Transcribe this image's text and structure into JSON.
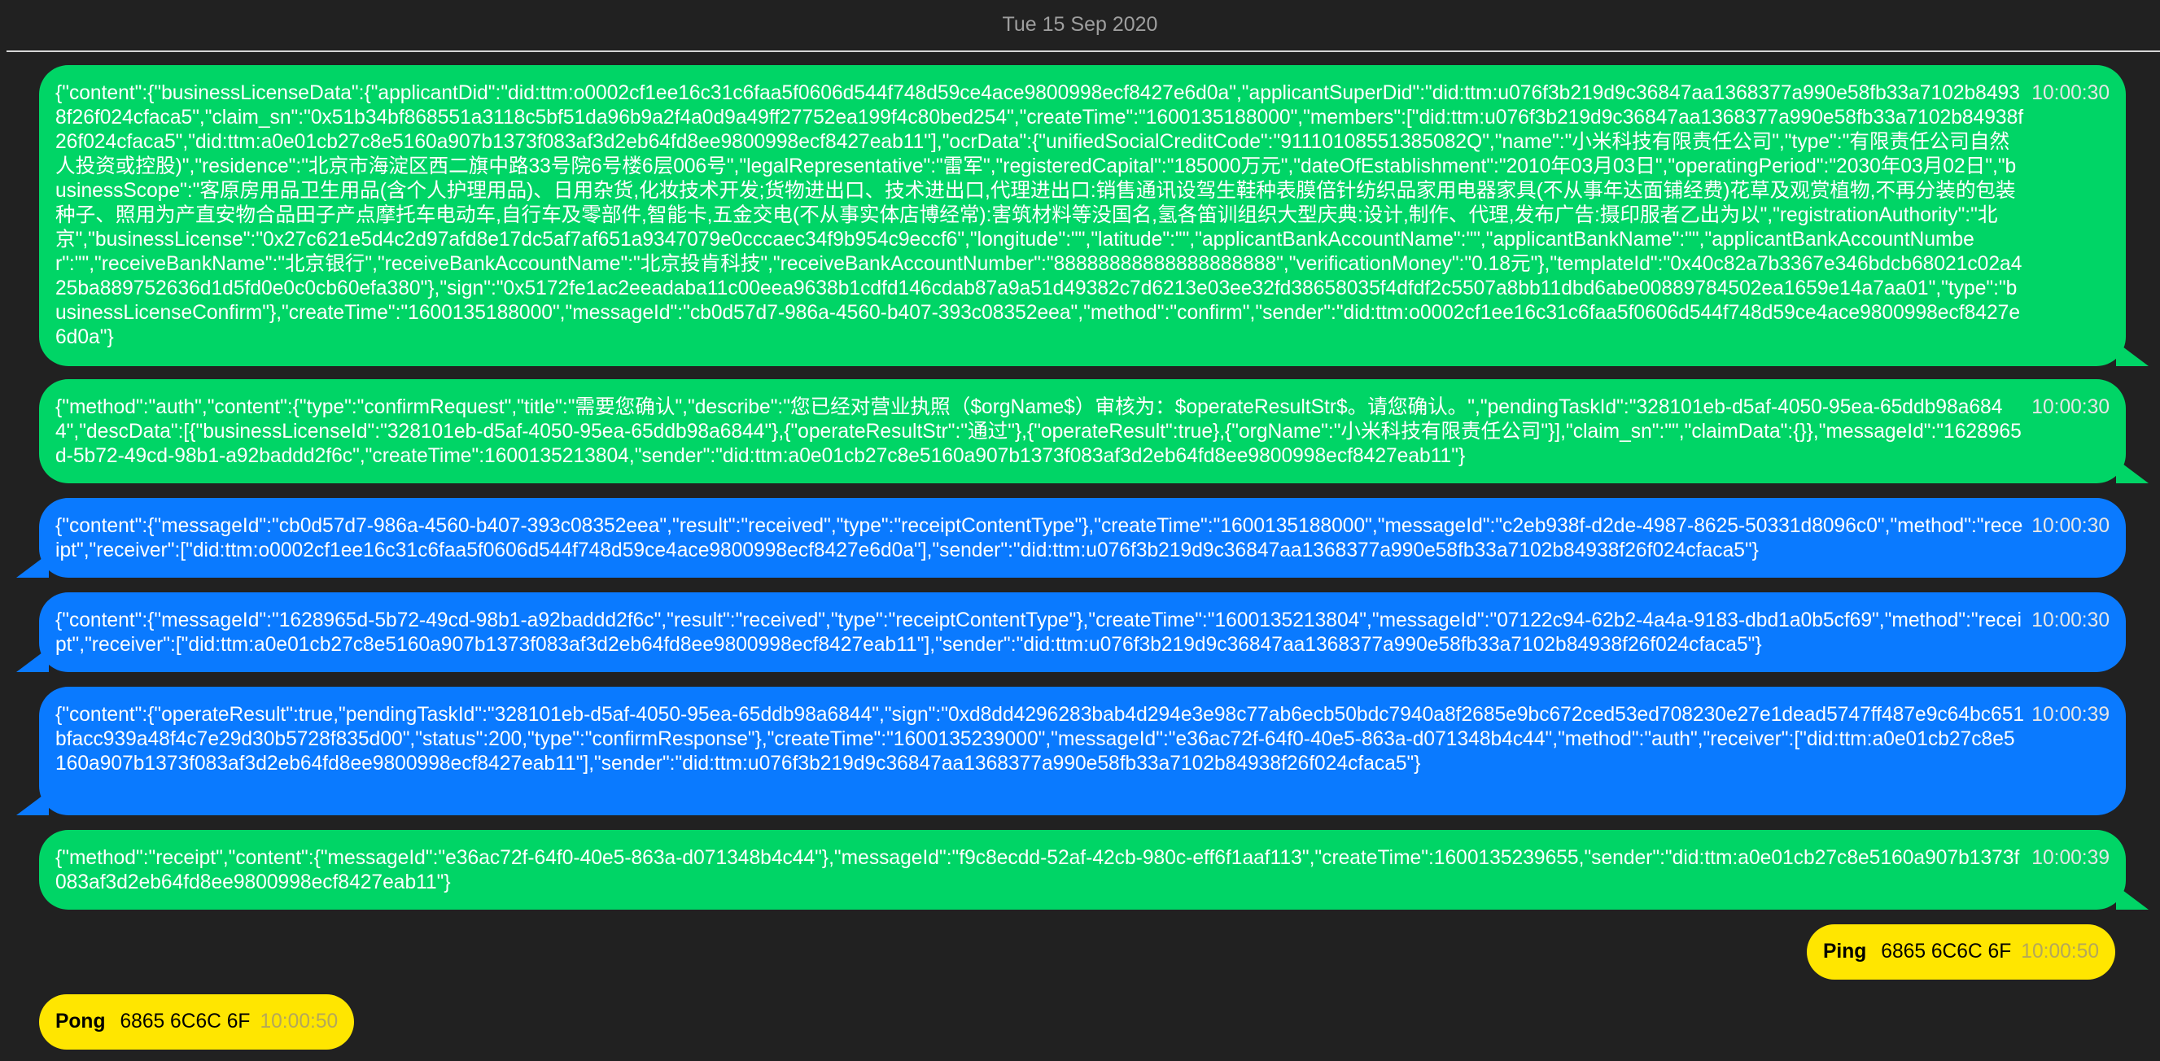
{
  "date_header": "Tue 15 Sep 2020",
  "messages": [
    {
      "side": "right",
      "color": "#00d566",
      "time": "10:00:30",
      "text": "{\"content\":{\"businessLicenseData\":{\"applicantDid\":\"did:ttm:o0002cf1ee16c31c6faa5f0606d544f748d59ce4ace9800998ecf8427e6d0a\",\"applicantSuperDid\":\"did:ttm:u076f3b219d9c36847aa1368377a990e58fb33a7102b84938f26f024cfaca5\",\"claim_sn\":\"0x51b34bf868551a3118c5bf51da96b9a2f4a0d9a49ff27752ea199f4c80bed254\",\"createTime\":\"1600135188000\",\"members\":[\"did:ttm:u076f3b219d9c36847aa1368377a990e58fb33a7102b84938f26f024cfaca5\",\"did:ttm:a0e01cb27c8e5160a907b1373f083af3d2eb64fd8ee9800998ecf8427eab11\"],\"ocrData\":{\"unifiedSocialCreditCode\":\"91110108551385082Q\",\"name\":\"小米科技有限责任公司\",\"type\":\"有限责任公司自然人投资或控股)\",\"residence\":\"北京市海淀区西二旗中路33号院6号楼6层006号\",\"legalRepresentative\":\"雷军\",\"registeredCapital\":\"185000万元\",\"dateOfEstablishment\":\"2010年03月03日\",\"operatingPeriod\":\"2030年03月02日\",\"businessScope\":\"客原房用品卫生用品(含个人护理用品)、日用杂货,化妆技术开发;货物进出口、技术进出口,代理进出口:销售通讯设驾生鞋种表膜倍针纺织品家用电器家具(不从事年达面铺经费)花草及观赏植物,不再分装的包装种子、照用为产直安物合品田子产点摩托车电动车,自行车及零部件,智能卡,五金交电(不从事实体店博经常):害筑材料等没国名,氢各笛训组织大型庆典:设计,制作、代理,发布广告:摄印服者乙出为以\",\"registrationAuthority\":\"北京\",\"businessLicense\":\"0x27c621e5d4c2d97afd8e17dc5af7af651a9347079e0cccaec34f9b954c9eccf6\",\"longitude\":\"\",\"latitude\":\"\",\"applicantBankAccountName\":\"\",\"applicantBankName\":\"\",\"applicantBankAccountNumber\":\"\",\"receiveBankName\":\"北京银行\",\"receiveBankAccountName\":\"北京投肯科技\",\"receiveBankAccountNumber\":\"88888888888888888888\",\"verificationMoney\":\"0.18元\"},\"templateId\":\"0x40c82a7b3367e346bdcb68021c02a425ba889752636d1d5fd0e0c0cb60efa380\"},\"sign\":\"0x5172fe1ac2eeadaba11c00eea9638b1cdfd146cdab87a9a51d49382c7d6213e03ee32fd38658035f4dfdf2c5507a8bb11dbd6abe00889784502ea1659e14a7aa01\",\"type\":\"businessLicenseConfirm\"},\"createTime\":\"1600135188000\",\"messageId\":\"cb0d57d7-986a-4560-b407-393c08352eea\",\"method\":\"confirm\",\"sender\":\"did:ttm:o0002cf1ee16c31c6faa5f0606d544f748d59ce4ace9800998ecf8427e6d0a\"}"
    },
    {
      "side": "right",
      "color": "#00d566",
      "time": "10:00:30",
      "text": "{\"method\":\"auth\",\"content\":{\"type\":\"confirmRequest\",\"title\":\"需要您确认\",\"describe\":\"您已经对营业执照（$orgName$）审核为：$operateResultStr$。请您确认。\",\"pendingTaskId\":\"328101eb-d5af-4050-95ea-65ddb98a6844\",\"descData\":[{\"businessLicenseId\":\"328101eb-d5af-4050-95ea-65ddb98a6844\"},{\"operateResultStr\":\"通过\"},{\"operateResult\":true},{\"orgName\":\"小米科技有限责任公司\"}],\"claim_sn\":\"\",\"claimData\":{}},\"messageId\":\"1628965d-5b72-49cd-98b1-a92baddd2f6c\",\"createTime\":1600135213804,\"sender\":\"did:ttm:a0e01cb27c8e5160a907b1373f083af3d2eb64fd8ee9800998ecf8427eab11\"}"
    },
    {
      "side": "left",
      "color": "#0a7aff",
      "time": "10:00:30",
      "text": "{\"content\":{\"messageId\":\"cb0d57d7-986a-4560-b407-393c08352eea\",\"result\":\"received\",\"type\":\"receiptContentType\"},\"createTime\":\"1600135188000\",\"messageId\":\"c2eb938f-d2de-4987-8625-50331d8096c0\",\"method\":\"receipt\",\"receiver\":[\"did:ttm:o0002cf1ee16c31c6faa5f0606d544f748d59ce4ace9800998ecf8427e6d0a\"],\"sender\":\"did:ttm:u076f3b219d9c36847aa1368377a990e58fb33a7102b84938f26f024cfaca5\"}"
    },
    {
      "side": "left",
      "color": "#0a7aff",
      "time": "10:00:30",
      "text": "{\"content\":{\"messageId\":\"1628965d-5b72-49cd-98b1-a92baddd2f6c\",\"result\":\"received\",\"type\":\"receiptContentType\"},\"createTime\":\"1600135213804\",\"messageId\":\"07122c94-62b2-4a4a-9183-dbd1a0b5cf69\",\"method\":\"receipt\",\"receiver\":[\"did:ttm:a0e01cb27c8e5160a907b1373f083af3d2eb64fd8ee9800998ecf8427eab11\"],\"sender\":\"did:ttm:u076f3b219d9c36847aa1368377a990e58fb33a7102b84938f26f024cfaca5\"}"
    },
    {
      "side": "left",
      "color": "#0a7aff",
      "time": "10:00:39",
      "text": "{\"content\":{\"operateResult\":true,\"pendingTaskId\":\"328101eb-d5af-4050-95ea-65ddb98a6844\",\"sign\":\"0xd8dd4296283bab4d294e3e98c77ab6ecb50bdc7940a8f2685e9bc672ced53ed708230e27e1dead5747ff487e9c64bc651bfacc939a48f4c7e29d30b5728f835d00\",\"status\":200,\"type\":\"confirmResponse\"},\"createTime\":\"1600135239000\",\"messageId\":\"e36ac72f-64f0-40e5-863a-d071348b4c44\",\"method\":\"auth\",\"receiver\":[\"did:ttm:a0e01cb27c8e5160a907b1373f083af3d2eb64fd8ee9800998ecf8427eab11\"],\"sender\":\"did:ttm:u076f3b219d9c36847aa1368377a990e58fb33a7102b84938f26f024cfaca5\"}"
    },
    {
      "side": "right",
      "color": "#00d566",
      "time": "10:00:39",
      "text": "{\"method\":\"receipt\",\"content\":{\"messageId\":\"e36ac72f-64f0-40e5-863a-d071348b4c44\"},\"messageId\":\"f9c8ecdd-52af-42cb-980c-eff6f1aaf113\",\"createTime\":1600135239655,\"sender\":\"did:ttm:a0e01cb27c8e5160a907b1373f083af3d2eb64fd8ee9800998ecf8427eab11\"}"
    }
  ],
  "ping": {
    "label": "Ping",
    "hex": "6865 6C6C 6F",
    "time": "10:00:50",
    "color": "#ffe600"
  },
  "pong": {
    "label": "Pong",
    "hex": "6865 6C6C 6F",
    "time": "10:00:50",
    "color": "#ffe600"
  }
}
